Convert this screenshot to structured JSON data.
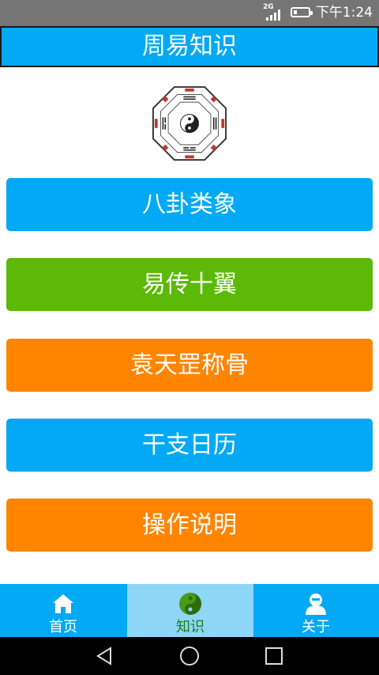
{
  "status": {
    "network": "2G",
    "time": "下午1:24"
  },
  "header": {
    "title": "周易知识"
  },
  "menu": [
    {
      "label": "八卦类象",
      "color": "#03a9f4"
    },
    {
      "label": "易传十翼",
      "color": "#5cb908"
    },
    {
      "label": "袁天罡称骨",
      "color": "#ff8400"
    },
    {
      "label": "干支日历",
      "color": "#03a9f4"
    },
    {
      "label": "操作说明",
      "color": "#ff8400"
    }
  ],
  "tabs": [
    {
      "label": "首页",
      "icon": "home-icon",
      "active": false
    },
    {
      "label": "知识",
      "icon": "yin-yang-icon",
      "active": true
    },
    {
      "label": "关于",
      "icon": "user-icon",
      "active": false
    }
  ],
  "colors": {
    "primary": "#03a9f4",
    "green": "#5cb908",
    "orange": "#ff8400",
    "active_tab": "#8fd7f7",
    "active_tab_text": "#1a7a1a"
  }
}
